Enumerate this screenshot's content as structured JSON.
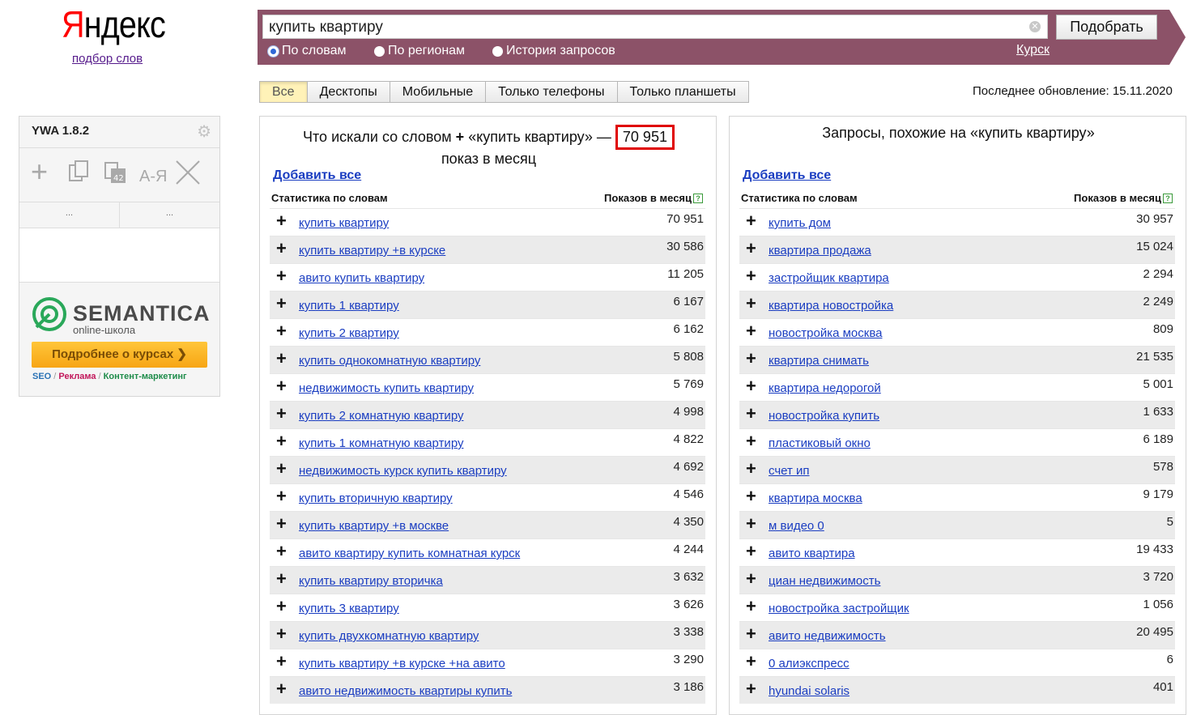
{
  "brand": {
    "logo_first": "Я",
    "logo_rest": "ндекс",
    "subtitle": "подбор слов"
  },
  "search": {
    "value": "купить квартиру",
    "button_label": "Подобрать",
    "modes": [
      "По словам",
      "По регионам",
      "История запросов"
    ],
    "selected_mode": 0,
    "region": "Курск"
  },
  "tabs": [
    "Все",
    "Десктопы",
    "Мобильные",
    "Только телефоны",
    "Только планшеты"
  ],
  "active_tab": 0,
  "last_update": "Последнее обновление: 15.11.2020",
  "ywa": {
    "title": "YWA 1.8.2",
    "tools": [
      "plus-icon",
      "copy-icon",
      "count-icon",
      "sort-az-icon",
      "close-icon"
    ],
    "sort_label": "А-Я",
    "count_badge": "42",
    "col1": "...",
    "col2": "...",
    "ad": {
      "name": "SEMANTICA",
      "sub": "online-школа",
      "button": "Подробнее о курсах ❯",
      "tag1": "SEO",
      "tag2": "Реклама",
      "tag3": "Контент-маркетинг",
      "sep": "/"
    }
  },
  "left_panel": {
    "head_text": "Что искали со словом",
    "head_plus": "+",
    "head_query": "«купить квартиру» —",
    "total": "70 951",
    "sub": "показ в месяц",
    "add_all": "Добавить все",
    "col_words": "Статистика по словам",
    "col_shows": "Показов в месяц",
    "help": "?",
    "rows": [
      {
        "kw": "купить квартиру",
        "n": "70 951"
      },
      {
        "kw": "купить квартиру +в курске",
        "n": "30 586"
      },
      {
        "kw": "авито купить квартиру",
        "n": "11 205"
      },
      {
        "kw": "купить 1 квартиру",
        "n": "6 167"
      },
      {
        "kw": "купить 2 квартиру",
        "n": "6 162"
      },
      {
        "kw": "купить однокомнатную квартиру",
        "n": "5 808"
      },
      {
        "kw": "недвижимость купить квартиру",
        "n": "5 769"
      },
      {
        "kw": "купить 2 комнатную квартиру",
        "n": "4 998"
      },
      {
        "kw": "купить 1 комнатную квартиру",
        "n": "4 822"
      },
      {
        "kw": "недвижимость курск купить квартиру",
        "n": "4 692"
      },
      {
        "kw": "купить вторичную квартиру",
        "n": "4 546"
      },
      {
        "kw": "купить квартиру +в москве",
        "n": "4 350"
      },
      {
        "kw": "авито квартиру купить комнатная курск",
        "n": "4 244"
      },
      {
        "kw": "купить квартиру вторичка",
        "n": "3 632"
      },
      {
        "kw": "купить 3 квартиру",
        "n": "3 626"
      },
      {
        "kw": "купить двухкомнатную квартиру",
        "n": "3 338"
      },
      {
        "kw": "купить квартиру +в курске +на авито",
        "n": "3 290"
      },
      {
        "kw": "авито недвижимость квартиры купить",
        "n": "3 186"
      }
    ]
  },
  "right_panel": {
    "head": "Запросы, похожие на «купить квартиру»",
    "add_all": "Добавить все",
    "col_words": "Статистика по словам",
    "col_shows": "Показов в месяц",
    "help": "?",
    "rows": [
      {
        "kw": "купить дом",
        "n": "30 957"
      },
      {
        "kw": "квартира продажа",
        "n": "15 024"
      },
      {
        "kw": "застройщик квартира",
        "n": "2 294"
      },
      {
        "kw": "квартира новостройка",
        "n": "2 249"
      },
      {
        "kw": "новостройка москва",
        "n": "809"
      },
      {
        "kw": "квартира снимать",
        "n": "21 535"
      },
      {
        "kw": "квартира недорогой",
        "n": "5 001"
      },
      {
        "kw": "новостройка купить",
        "n": "1 633"
      },
      {
        "kw": "пластиковый окно",
        "n": "6 189"
      },
      {
        "kw": "счет ип",
        "n": "578"
      },
      {
        "kw": "квартира москва",
        "n": "9 179"
      },
      {
        "kw": "м видео 0",
        "n": "5"
      },
      {
        "kw": "авито квартира",
        "n": "19 433"
      },
      {
        "kw": "циан недвижимость",
        "n": "3 720"
      },
      {
        "kw": "новостройка застройщик",
        "n": "1 056"
      },
      {
        "kw": "авито недвижимость",
        "n": "20 495"
      },
      {
        "kw": "0 алиэкспресс",
        "n": "6"
      },
      {
        "kw": "hyundai solaris",
        "n": "401"
      }
    ]
  },
  "colors": {
    "band": "#8c5268",
    "link": "#1a3dc1",
    "highlight": "#e00000",
    "active_tab": "#fff2b8"
  }
}
